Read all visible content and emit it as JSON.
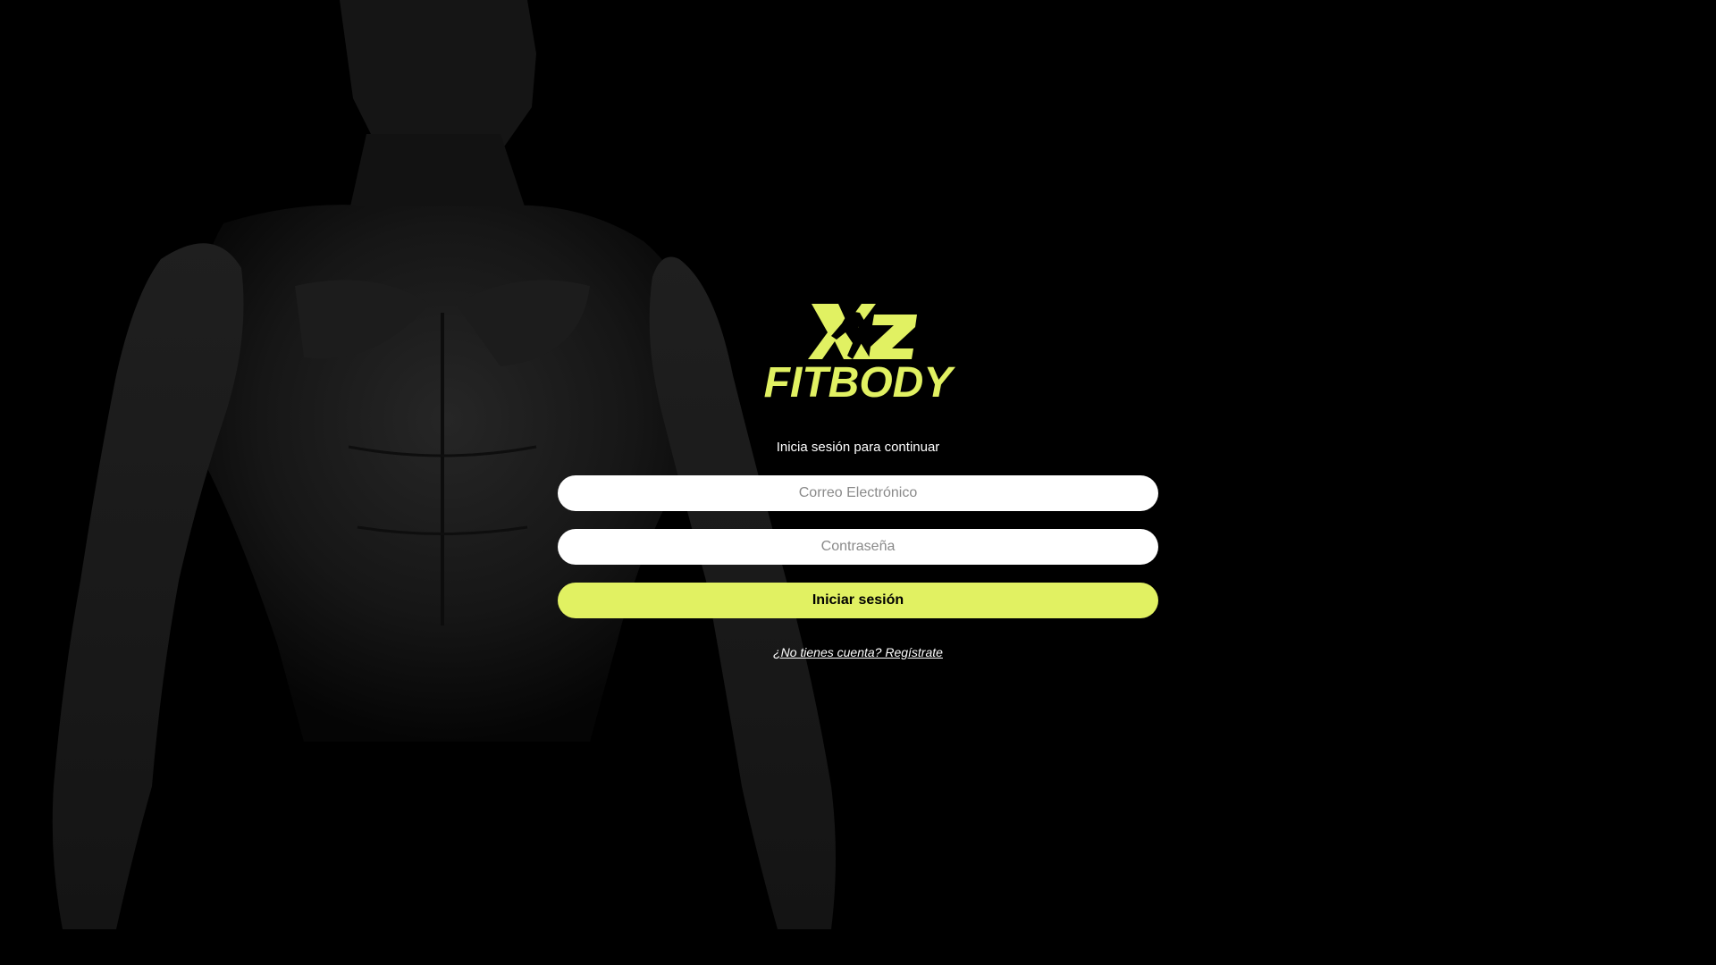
{
  "brand": {
    "name": "FITBODY",
    "accent_color": "#e1f162",
    "logo_icon": "xz-runner-logo-icon"
  },
  "background": {
    "image_icon": "muscular-torso-silhouette"
  },
  "login": {
    "subtitle": "Inicia sesión para continuar",
    "email_placeholder": "Correo Electrónico",
    "password_placeholder": "Contraseña",
    "submit_label": "Iniciar sesión",
    "register_link": "¿No tienes cuenta? Regístrate"
  }
}
